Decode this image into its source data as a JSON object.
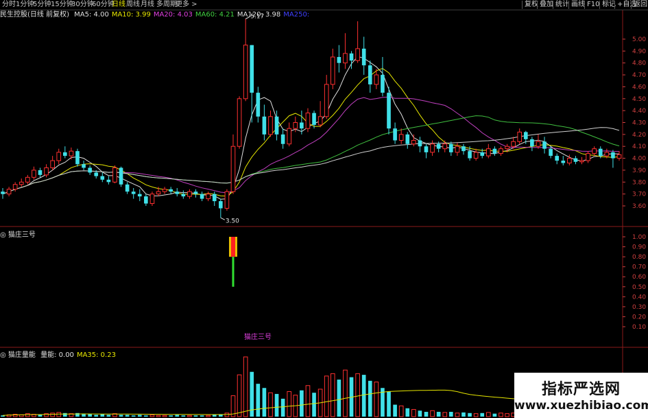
{
  "tabs": [
    "分时",
    "1分钟",
    "5分钟",
    "15分钟",
    "30分钟",
    "60分钟",
    "日线",
    "周线",
    "月线",
    "多周期",
    "更多 >"
  ],
  "active_tab": "日线",
  "right_buttons": [
    "复权",
    "叠加",
    "统计",
    "画线",
    "F10",
    "标记",
    "+自选",
    "返回"
  ],
  "stock": {
    "title": "民生控股(日线 前复权)"
  },
  "ma_legend": [
    {
      "text": "MA5: 4.00",
      "color": "#e0e0e0"
    },
    {
      "text": "MA10: 3.99",
      "color": "#e6e600"
    },
    {
      "text": "MA20: 4.03",
      "color": "#e040e0"
    },
    {
      "text": "MA60: 4.21",
      "color": "#40d040"
    },
    {
      "text": "MA120: 3.98",
      "color": "#e0e0e0"
    },
    {
      "text": "MA250:",
      "color": "#4040ff"
    }
  ],
  "price_axis": [
    "5.00",
    "4.90",
    "4.80",
    "4.70",
    "4.60",
    "4.50",
    "4.40",
    "4.30",
    "4.20",
    "4.10",
    "4.00",
    "3.90",
    "3.80",
    "3.70",
    "3.60"
  ],
  "high_label": "5.17",
  "low_label": "3.50",
  "indicator1": {
    "title": "猫庄三号",
    "inline_label": "猫庄三号",
    "axis": [
      "1.00",
      "0.90",
      "0.80",
      "0.70",
      "0.60",
      "0.50",
      "0.40",
      "0.30",
      "0.20",
      "0.10"
    ]
  },
  "indicator2": {
    "title": "猫庄量能",
    "legend": [
      {
        "text": "量能: 0.00",
        "color": "#e0e0e0"
      },
      {
        "text": "MA35: 0.23",
        "color": "#e6e600"
      }
    ]
  },
  "watermark": {
    "cn": "指标严选网",
    "url": "www.xuezhibiao.com"
  },
  "colors": {
    "up": "#ff3030",
    "down": "#40e0e8",
    "grid": "#8b1a1a",
    "ma5": "#e0e0e0",
    "ma10": "#e6e600",
    "ma20": "#c040c0",
    "ma60": "#40c040",
    "ma120": "#d0d0d0"
  },
  "candles": [
    [
      3.72,
      3.7,
      3.75,
      3.66
    ],
    [
      3.7,
      3.74,
      3.76,
      3.68
    ],
    [
      3.74,
      3.78,
      3.8,
      3.72
    ],
    [
      3.78,
      3.8,
      3.83,
      3.76
    ],
    [
      3.8,
      3.84,
      3.86,
      3.78
    ],
    [
      3.84,
      3.9,
      3.93,
      3.82
    ],
    [
      3.9,
      3.86,
      3.92,
      3.84
    ],
    [
      3.86,
      3.92,
      3.95,
      3.84
    ],
    [
      3.92,
      3.98,
      4.02,
      3.9
    ],
    [
      3.98,
      4.05,
      4.08,
      3.95
    ],
    [
      4.05,
      4.02,
      4.1,
      4.0
    ],
    [
      4.02,
      4.06,
      4.09,
      3.99
    ],
    [
      4.06,
      3.95,
      4.08,
      3.93
    ],
    [
      3.95,
      3.92,
      3.98,
      3.9
    ],
    [
      3.92,
      3.88,
      3.94,
      3.86
    ],
    [
      3.88,
      3.85,
      3.9,
      3.83
    ],
    [
      3.85,
      3.82,
      3.88,
      3.8
    ],
    [
      3.82,
      3.8,
      3.85,
      3.78
    ],
    [
      3.8,
      3.92,
      3.94,
      3.79
    ],
    [
      3.92,
      3.78,
      3.93,
      3.76
    ],
    [
      3.78,
      3.72,
      3.8,
      3.7
    ],
    [
      3.72,
      3.7,
      3.75,
      3.66
    ],
    [
      3.7,
      3.68,
      3.74,
      3.64
    ],
    [
      3.68,
      3.62,
      3.7,
      3.6
    ],
    [
      3.62,
      3.7,
      3.72,
      3.6
    ],
    [
      3.7,
      3.72,
      3.76,
      3.68
    ],
    [
      3.72,
      3.74,
      3.76,
      3.7
    ],
    [
      3.74,
      3.72,
      3.76,
      3.7
    ],
    [
      3.72,
      3.7,
      3.75,
      3.68
    ],
    [
      3.7,
      3.68,
      3.73,
      3.66
    ],
    [
      3.68,
      3.72,
      3.74,
      3.66
    ],
    [
      3.72,
      3.7,
      3.74,
      3.67
    ],
    [
      3.7,
      3.66,
      3.72,
      3.64
    ],
    [
      3.66,
      3.7,
      3.72,
      3.64
    ],
    [
      3.7,
      3.64,
      3.72,
      3.6
    ],
    [
      3.64,
      3.58,
      3.66,
      3.5
    ],
    [
      3.58,
      3.72,
      3.74,
      3.56
    ],
    [
      3.72,
      4.1,
      4.2,
      3.7
    ],
    [
      4.1,
      4.5,
      4.52,
      4.08
    ],
    [
      4.5,
      4.95,
      5.17,
      4.48
    ],
    [
      4.95,
      4.55,
      4.95,
      4.3
    ],
    [
      4.55,
      4.35,
      4.6,
      4.3
    ],
    [
      4.35,
      4.2,
      4.45,
      4.15
    ],
    [
      4.2,
      4.35,
      4.4,
      4.18
    ],
    [
      4.35,
      4.2,
      4.4,
      4.15
    ],
    [
      4.2,
      4.12,
      4.25,
      4.08
    ],
    [
      4.12,
      4.25,
      4.3,
      4.1
    ],
    [
      4.25,
      4.3,
      4.35,
      4.22
    ],
    [
      4.3,
      4.25,
      4.4,
      4.2
    ],
    [
      4.25,
      4.38,
      4.42,
      4.22
    ],
    [
      4.38,
      4.28,
      4.4,
      4.25
    ],
    [
      4.28,
      4.35,
      4.48,
      4.26
    ],
    [
      4.35,
      4.62,
      4.7,
      4.33
    ],
    [
      4.62,
      4.85,
      4.92,
      4.58
    ],
    [
      4.85,
      4.8,
      4.95,
      4.72
    ],
    [
      4.8,
      4.88,
      5.05,
      4.75
    ],
    [
      4.88,
      4.82,
      4.9,
      4.75
    ],
    [
      4.82,
      4.92,
      5.15,
      4.8
    ],
    [
      4.92,
      4.78,
      5.02,
      4.7
    ],
    [
      4.78,
      4.62,
      4.82,
      4.55
    ],
    [
      4.62,
      4.7,
      4.75,
      4.58
    ],
    [
      4.7,
      4.55,
      4.85,
      4.52
    ],
    [
      4.55,
      4.25,
      4.6,
      4.2
    ],
    [
      4.25,
      4.15,
      4.3,
      4.12
    ],
    [
      4.15,
      4.2,
      4.25,
      4.12
    ],
    [
      4.2,
      4.12,
      4.22,
      4.08
    ],
    [
      4.12,
      4.15,
      4.2,
      4.1
    ],
    [
      4.15,
      4.1,
      4.18,
      4.05
    ],
    [
      4.1,
      4.05,
      4.12,
      4.0
    ],
    [
      4.05,
      4.12,
      4.15,
      4.02
    ],
    [
      4.12,
      4.08,
      4.14,
      4.05
    ],
    [
      4.08,
      4.12,
      4.15,
      4.05
    ],
    [
      4.12,
      4.05,
      4.14,
      4.02
    ],
    [
      4.05,
      4.1,
      4.13,
      4.02
    ],
    [
      4.1,
      4.06,
      4.12,
      4.03
    ],
    [
      4.06,
      4.0,
      4.1,
      3.98
    ],
    [
      4.0,
      4.05,
      4.08,
      3.98
    ],
    [
      4.05,
      4.02,
      4.08,
      4.0
    ],
    [
      4.02,
      4.08,
      4.12,
      4.0
    ],
    [
      4.08,
      4.04,
      4.1,
      4.02
    ],
    [
      4.04,
      4.08,
      4.1,
      4.02
    ],
    [
      4.08,
      4.1,
      4.12,
      4.05
    ],
    [
      4.1,
      4.14,
      4.18,
      4.08
    ],
    [
      4.14,
      4.22,
      4.25,
      4.12
    ],
    [
      4.22,
      4.16,
      4.23,
      4.12
    ],
    [
      4.16,
      4.1,
      4.18,
      4.06
    ],
    [
      4.1,
      4.14,
      4.2,
      4.08
    ],
    [
      4.14,
      4.08,
      4.18,
      4.04
    ],
    [
      4.08,
      4.02,
      4.1,
      4.0
    ],
    [
      4.02,
      3.98,
      4.04,
      3.95
    ],
    [
      3.98,
      3.96,
      4.02,
      3.94
    ],
    [
      3.96,
      4.0,
      4.03,
      3.94
    ],
    [
      4.0,
      3.97,
      4.02,
      3.95
    ],
    [
      3.97,
      3.98,
      4.01,
      3.95
    ],
    [
      3.98,
      4.04,
      4.06,
      3.96
    ],
    [
      4.04,
      4.08,
      4.1,
      4.02
    ],
    [
      4.08,
      4.02,
      4.1,
      4.0
    ],
    [
      4.02,
      4.05,
      4.08,
      4.0
    ],
    [
      4.05,
      4.0,
      4.07,
      3.92
    ],
    [
      4.0,
      4.03,
      4.06,
      3.98
    ]
  ],
  "volumes": [
    0.02,
    0.03,
    0.04,
    0.03,
    0.05,
    0.04,
    0.03,
    0.05,
    0.06,
    0.07,
    0.06,
    0.05,
    0.06,
    0.05,
    0.04,
    0.03,
    0.04,
    0.03,
    0.05,
    0.03,
    0.03,
    0.02,
    0.03,
    0.02,
    0.03,
    0.02,
    0.02,
    0.02,
    0.03,
    0.02,
    0.02,
    0.02,
    0.02,
    0.02,
    0.03,
    0.04,
    0.06,
    0.35,
    0.7,
    1.0,
    0.75,
    0.55,
    0.48,
    0.4,
    0.38,
    0.3,
    0.42,
    0.36,
    0.44,
    0.52,
    0.4,
    0.46,
    0.68,
    0.72,
    0.62,
    0.78,
    0.66,
    0.72,
    0.7,
    0.6,
    0.58,
    0.48,
    0.42,
    0.2,
    0.18,
    0.14,
    0.12,
    0.1,
    0.08,
    0.1,
    0.08,
    0.07,
    0.08,
    0.06,
    0.07,
    0.06,
    0.05,
    0.06,
    0.07,
    0.05,
    0.06,
    0.05,
    0.06,
    0.08,
    0.07,
    0.06,
    0.05,
    0.06,
    0.05,
    0.04,
    0.04,
    0.05,
    0.04,
    0.04,
    0.05,
    0.06,
    0.05,
    0.04,
    0.05,
    0.04
  ],
  "ind1_bar": {
    "index": 37,
    "red_top": 1.0,
    "red_bottom": 0.8,
    "green_bottom": 0.5
  }
}
